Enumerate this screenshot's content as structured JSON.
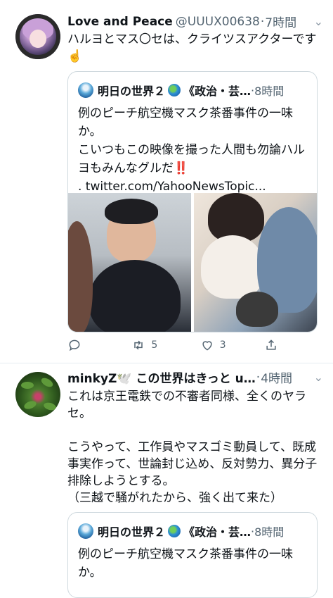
{
  "tweet1": {
    "display_name": "Love and Peace",
    "handle": "@UUUX00638",
    "separator": "·",
    "time": "7時間",
    "text": "ハルヨとマス〇セは、クライツスアクターです☝️",
    "quote": {
      "display_name": "明日の世界２",
      "name_suffix": "《政治・芸…",
      "separator": "·",
      "time": "8時間",
      "text_lines": [
        "例のピーチ航空機マスク茶番事件の一味か。",
        "こいつもこの映像を撮った人間も勿論ハルヨもみんなグルだ",
        ". twitter.com/YahooNewsTopic..."
      ],
      "emphasis": "‼️"
    },
    "actions": {
      "reply_count": "",
      "retweet_count": "5",
      "like_count": "3"
    }
  },
  "tweet2": {
    "display_name": "minkyZ🕊️ この世界はきっと u…",
    "separator": "·",
    "time": "4時間",
    "text": "これは京王電鉄での不審者同様、全くのヤラセ。\n\nこうやって、工作員やマスゴミ動員して、既成事実作って、世論封じ込め、反対勢力、異分子排除しようとする。\n（三越で騒がれたから、強く出て来た）",
    "quote": {
      "display_name": "明日の世界２",
      "name_suffix": "《政治・芸…",
      "separator": "·",
      "time": "8時間",
      "text": "例のピーチ航空機マスク茶番事件の一味か。"
    }
  },
  "icons": [
    "more-caret-icon",
    "reply-icon",
    "retweet-icon",
    "like-icon",
    "share-icon",
    "globe-icon"
  ]
}
